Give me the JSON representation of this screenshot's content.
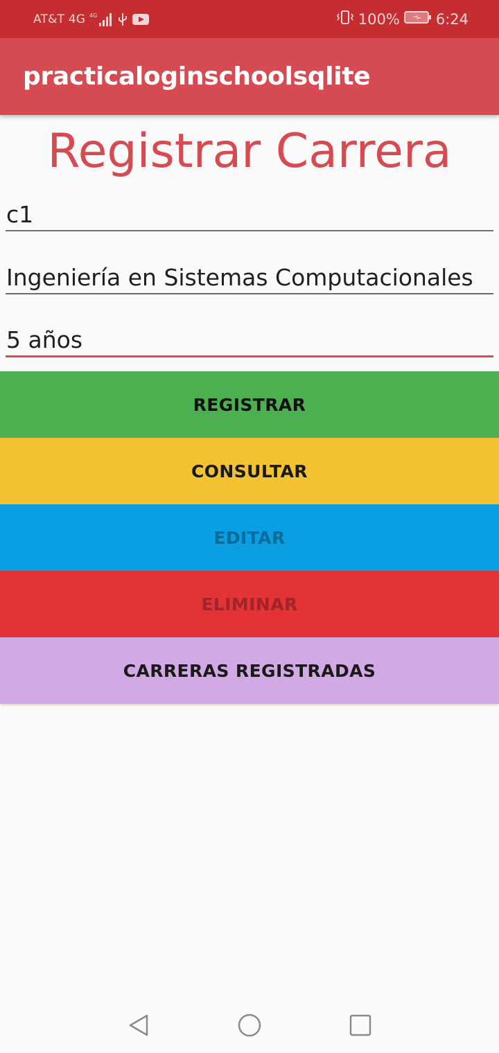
{
  "status_bar": {
    "carrier": "AT&T 4G",
    "network_badge": "4G LTE",
    "battery_percent": "100%",
    "time": "6:24",
    "icons": [
      "signal-icon",
      "usb-icon",
      "youtube-icon",
      "vibrate-icon",
      "battery-icon"
    ]
  },
  "app_bar": {
    "title": "practicaloginschoolsqlite"
  },
  "main": {
    "title": "Registrar Carrera",
    "fields": [
      {
        "name": "codigo",
        "value": "c1"
      },
      {
        "name": "nombre",
        "value": "Ingeniería en Sistemas Computacionales"
      },
      {
        "name": "duracion",
        "value": "5 años",
        "focused": true
      }
    ],
    "buttons": [
      {
        "label": "REGISTRAR",
        "bg": "#4caf50",
        "fg": "#111111"
      },
      {
        "label": "CONSULTAR",
        "bg": "#f2c232",
        "fg": "#1a1a1a"
      },
      {
        "label": "EDITAR",
        "bg": "#0a9fe3",
        "fg": "#0b6c9a"
      },
      {
        "label": "ELIMINAR",
        "bg": "#e33336",
        "fg": "#a0242a"
      },
      {
        "label": "CARRERAS REGISTRADAS",
        "bg": "#d1a9e5",
        "fg": "#1a1a1a"
      }
    ]
  },
  "nav_bar": {
    "icons": [
      "back-icon",
      "home-icon",
      "recents-icon"
    ]
  },
  "colors": {
    "status_bar": "#c62d30",
    "app_bar": "#d64b51",
    "accent": "#d64b51",
    "background": "#fafafa"
  }
}
